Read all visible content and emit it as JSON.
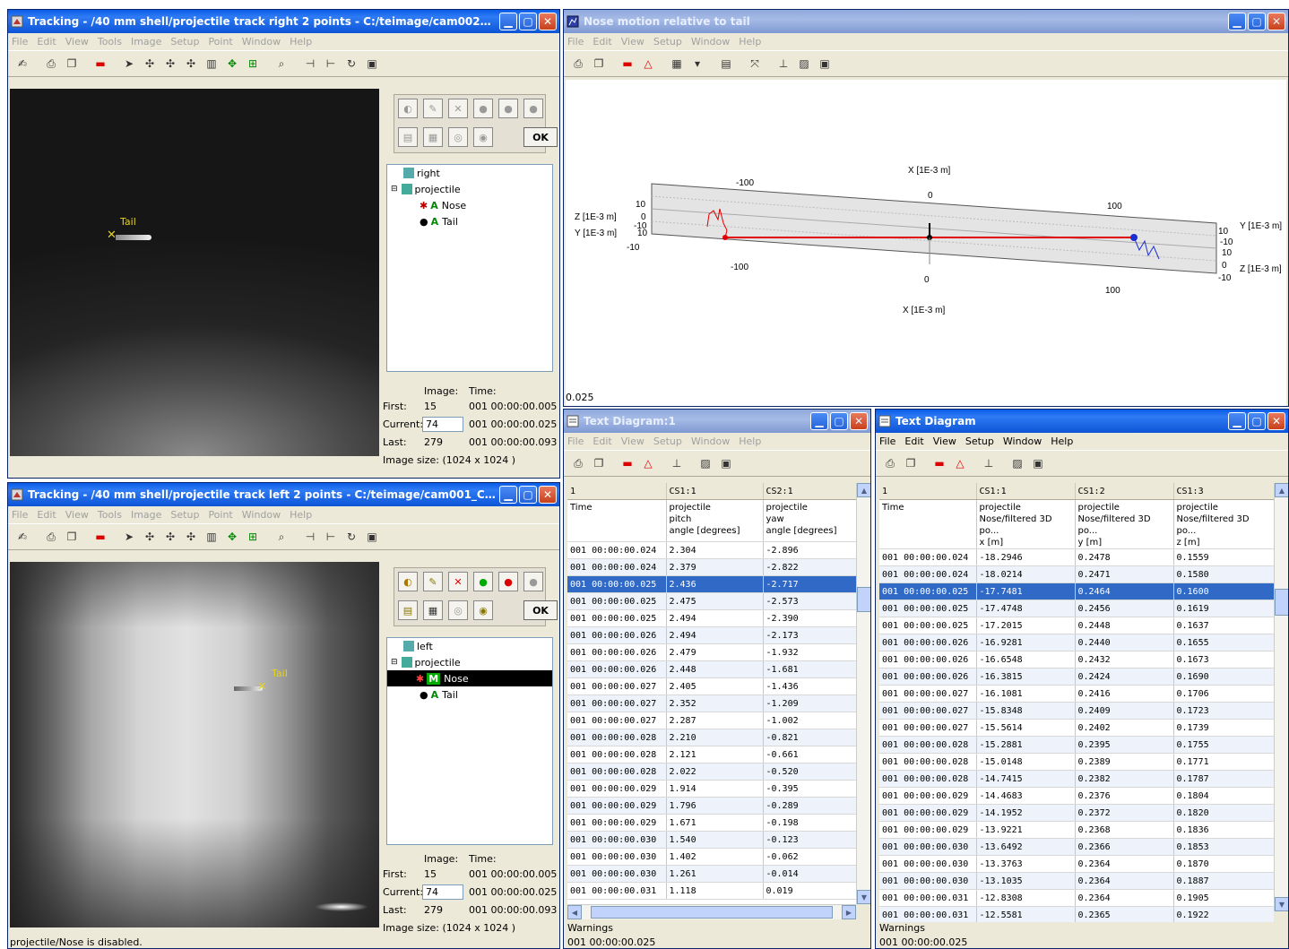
{
  "colors": {
    "track_red": "#e00000",
    "track_blue": "#1a2fd0",
    "selection": "#3169c6",
    "label_yellow": "#e6d21a"
  },
  "win_right": {
    "title": "Tracking - /40 mm shell/projectile track right 2 points - C:/teimage/cam002_C001...",
    "menu": [
      "File",
      "Edit",
      "View",
      "Tools",
      "Image",
      "Setup",
      "Point",
      "Window",
      "Help"
    ],
    "ok_label": "OK",
    "tree": {
      "camera": "right",
      "object": "projectile",
      "point1": "Nose",
      "point2": "Tail",
      "flag": "A"
    },
    "image_label": "Image:",
    "time_label": "Time:",
    "first_label": "First:",
    "first_image": "15",
    "first_time": "001 00:00:00.005",
    "current_label": "Current:",
    "current_image": "74",
    "current_time": "001 00:00:00.025",
    "last_label": "Last:",
    "last_image": "279",
    "last_time": "001 00:00:00.093",
    "image_size": "Image size: (1024 x 1024 )",
    "overlay_label": "Tail"
  },
  "win_left": {
    "title": "Tracking - /40 mm shell/projectile track left 2 points - C:/teimage/cam001_C0015...",
    "menu": [
      "File",
      "Edit",
      "View",
      "Tools",
      "Image",
      "Setup",
      "Point",
      "Window",
      "Help"
    ],
    "ok_label": "OK",
    "tree": {
      "camera": "left",
      "object": "projectile",
      "point1": "Nose",
      "point2": "Tail",
      "flag_sel": "M",
      "flag": "A"
    },
    "image_label": "Image:",
    "time_label": "Time:",
    "first_label": "First:",
    "first_image": "15",
    "first_time": "001 00:00:00.005",
    "current_label": "Current:",
    "current_image": "74",
    "current_time": "001 00:00:00.025",
    "last_label": "Last:",
    "last_image": "279",
    "last_time": "001 00:00:00.093",
    "image_size": "Image size: (1024 x 1024 )",
    "overlay_label": "Tail",
    "status": "projectile/Nose is disabled."
  },
  "win_motion": {
    "title": "Nose motion relative to tail",
    "menu": [
      "File",
      "Edit",
      "View",
      "Setup",
      "Window",
      "Help"
    ],
    "status_value": "0.025",
    "axes": {
      "x_top_label": "X [1E-3 m]",
      "x_bottom_label": "X [1E-3 m]",
      "z_left_label": "Z [1E-3 m]",
      "y_left_label": "Y [1E-3 m]",
      "y_right_label": "Y [1E-3 m]",
      "z_right_label": "Z [1E-3 m]",
      "x_top_ticks": [
        "-100",
        "0",
        "100"
      ],
      "x_bottom_ticks": [
        "-100",
        "0",
        "100"
      ],
      "left_ticks": [
        "10",
        "0",
        "-10",
        "10",
        "-10"
      ],
      "right_ticks": [
        "10",
        "-10",
        "10",
        "0",
        "-10"
      ]
    }
  },
  "win_text1": {
    "title": "Text Diagram:1",
    "menu": [
      "File",
      "Edit",
      "View",
      "Setup",
      "Window",
      "Help"
    ],
    "header": [
      "1",
      "CS1:1",
      "CS2:1"
    ],
    "subheader": [
      "Time",
      "projectile\npitch\nangle [degrees]",
      "projectile\nyaw\nangle [degrees]"
    ],
    "rows": [
      [
        "001 00:00:00.024",
        "2.304",
        "-2.896"
      ],
      [
        "001 00:00:00.024",
        "2.379",
        "-2.822"
      ],
      [
        "001 00:00:00.025",
        "2.436",
        "-2.717"
      ],
      [
        "001 00:00:00.025",
        "2.475",
        "-2.573"
      ],
      [
        "001 00:00:00.025",
        "2.494",
        "-2.390"
      ],
      [
        "001 00:00:00.026",
        "2.494",
        "-2.173"
      ],
      [
        "001 00:00:00.026",
        "2.479",
        "-1.932"
      ],
      [
        "001 00:00:00.026",
        "2.448",
        "-1.681"
      ],
      [
        "001 00:00:00.027",
        "2.405",
        "-1.436"
      ],
      [
        "001 00:00:00.027",
        "2.352",
        "-1.209"
      ],
      [
        "001 00:00:00.027",
        "2.287",
        "-1.002"
      ],
      [
        "001 00:00:00.028",
        "2.210",
        "-0.821"
      ],
      [
        "001 00:00:00.028",
        "2.121",
        "-0.661"
      ],
      [
        "001 00:00:00.028",
        "2.022",
        "-0.520"
      ],
      [
        "001 00:00:00.029",
        "1.914",
        "-0.395"
      ],
      [
        "001 00:00:00.029",
        "1.796",
        "-0.289"
      ],
      [
        "001 00:00:00.029",
        "1.671",
        "-0.198"
      ],
      [
        "001 00:00:00.030",
        "1.540",
        "-0.123"
      ],
      [
        "001 00:00:00.030",
        "1.402",
        "-0.062"
      ],
      [
        "001 00:00:00.030",
        "1.261",
        "-0.014"
      ],
      [
        "001 00:00:00.031",
        "1.118",
        "0.019"
      ]
    ],
    "selected_row": 2,
    "warnings_label": "Warnings",
    "status_time": "001 00:00:00.025"
  },
  "win_text2": {
    "title": "Text Diagram",
    "menu": [
      "File",
      "Edit",
      "View",
      "Setup",
      "Window",
      "Help"
    ],
    "header": [
      "1",
      "CS1:1",
      "CS1:2",
      "CS1:3"
    ],
    "subheader": [
      "Time",
      "projectile\nNose/filtered 3D po...\nx [m]",
      "projectile\nNose/filtered 3D po...\ny [m]",
      "projectile\nNose/filtered 3D po...\nz [m]"
    ],
    "rows": [
      [
        "001 00:00:00.024",
        "-18.2946",
        "0.2478",
        "0.1559"
      ],
      [
        "001 00:00:00.024",
        "-18.0214",
        "0.2471",
        "0.1580"
      ],
      [
        "001 00:00:00.025",
        "-17.7481",
        "0.2464",
        "0.1600"
      ],
      [
        "001 00:00:00.025",
        "-17.4748",
        "0.2456",
        "0.1619"
      ],
      [
        "001 00:00:00.025",
        "-17.2015",
        "0.2448",
        "0.1637"
      ],
      [
        "001 00:00:00.026",
        "-16.9281",
        "0.2440",
        "0.1655"
      ],
      [
        "001 00:00:00.026",
        "-16.6548",
        "0.2432",
        "0.1673"
      ],
      [
        "001 00:00:00.026",
        "-16.3815",
        "0.2424",
        "0.1690"
      ],
      [
        "001 00:00:00.027",
        "-16.1081",
        "0.2416",
        "0.1706"
      ],
      [
        "001 00:00:00.027",
        "-15.8348",
        "0.2409",
        "0.1723"
      ],
      [
        "001 00:00:00.027",
        "-15.5614",
        "0.2402",
        "0.1739"
      ],
      [
        "001 00:00:00.028",
        "-15.2881",
        "0.2395",
        "0.1755"
      ],
      [
        "001 00:00:00.028",
        "-15.0148",
        "0.2389",
        "0.1771"
      ],
      [
        "001 00:00:00.028",
        "-14.7415",
        "0.2382",
        "0.1787"
      ],
      [
        "001 00:00:00.029",
        "-14.4683",
        "0.2376",
        "0.1804"
      ],
      [
        "001 00:00:00.029",
        "-14.1952",
        "0.2372",
        "0.1820"
      ],
      [
        "001 00:00:00.029",
        "-13.9221",
        "0.2368",
        "0.1836"
      ],
      [
        "001 00:00:00.030",
        "-13.6492",
        "0.2366",
        "0.1853"
      ],
      [
        "001 00:00:00.030",
        "-13.3763",
        "0.2364",
        "0.1870"
      ],
      [
        "001 00:00:00.030",
        "-13.1035",
        "0.2364",
        "0.1887"
      ],
      [
        "001 00:00:00.031",
        "-12.8308",
        "0.2364",
        "0.1905"
      ],
      [
        "001 00:00:00.031",
        "-12.5581",
        "0.2365",
        "0.1922"
      ]
    ],
    "selected_row": 2,
    "warnings_label": "Warnings",
    "status_time": "001 00:00:00.025"
  }
}
